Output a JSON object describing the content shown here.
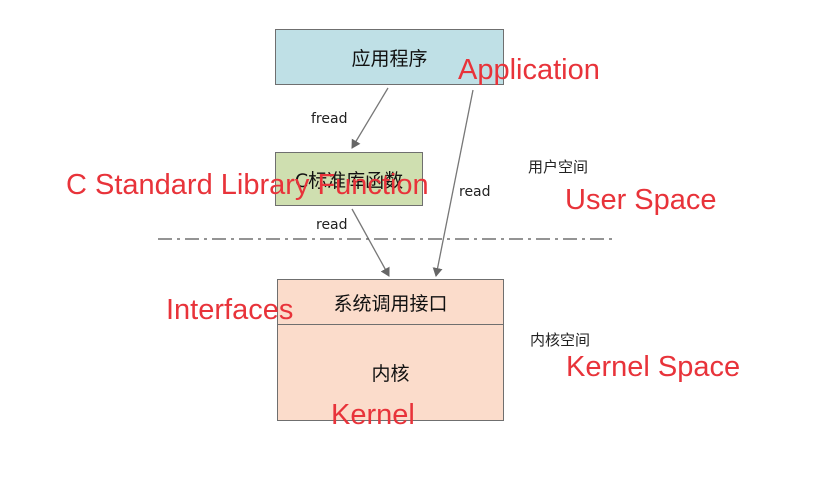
{
  "boxes": {
    "application": "应用程序",
    "c_library": "C标准库函数",
    "syscall_interface": "系统调用接口",
    "kernel": "内核"
  },
  "arrow_labels": {
    "fread": "fread",
    "read_lib": "read",
    "read_direct": "read"
  },
  "region_labels": {
    "user_space_cn": "用户空间",
    "kernel_space_cn": "内核空间"
  },
  "annotations": {
    "application": "Application",
    "c_standard_library_function": "C Standard Library Function",
    "user_space": "User Space",
    "interfaces": "Interfaces",
    "kernel_space": "Kernel Space",
    "kernel": "Kernel"
  },
  "colors": {
    "application_box": "#bfe0e6",
    "c_library_box": "#cfdfb0",
    "kernel_box": "#fbdccb",
    "annotation_red": "#e8333a"
  }
}
